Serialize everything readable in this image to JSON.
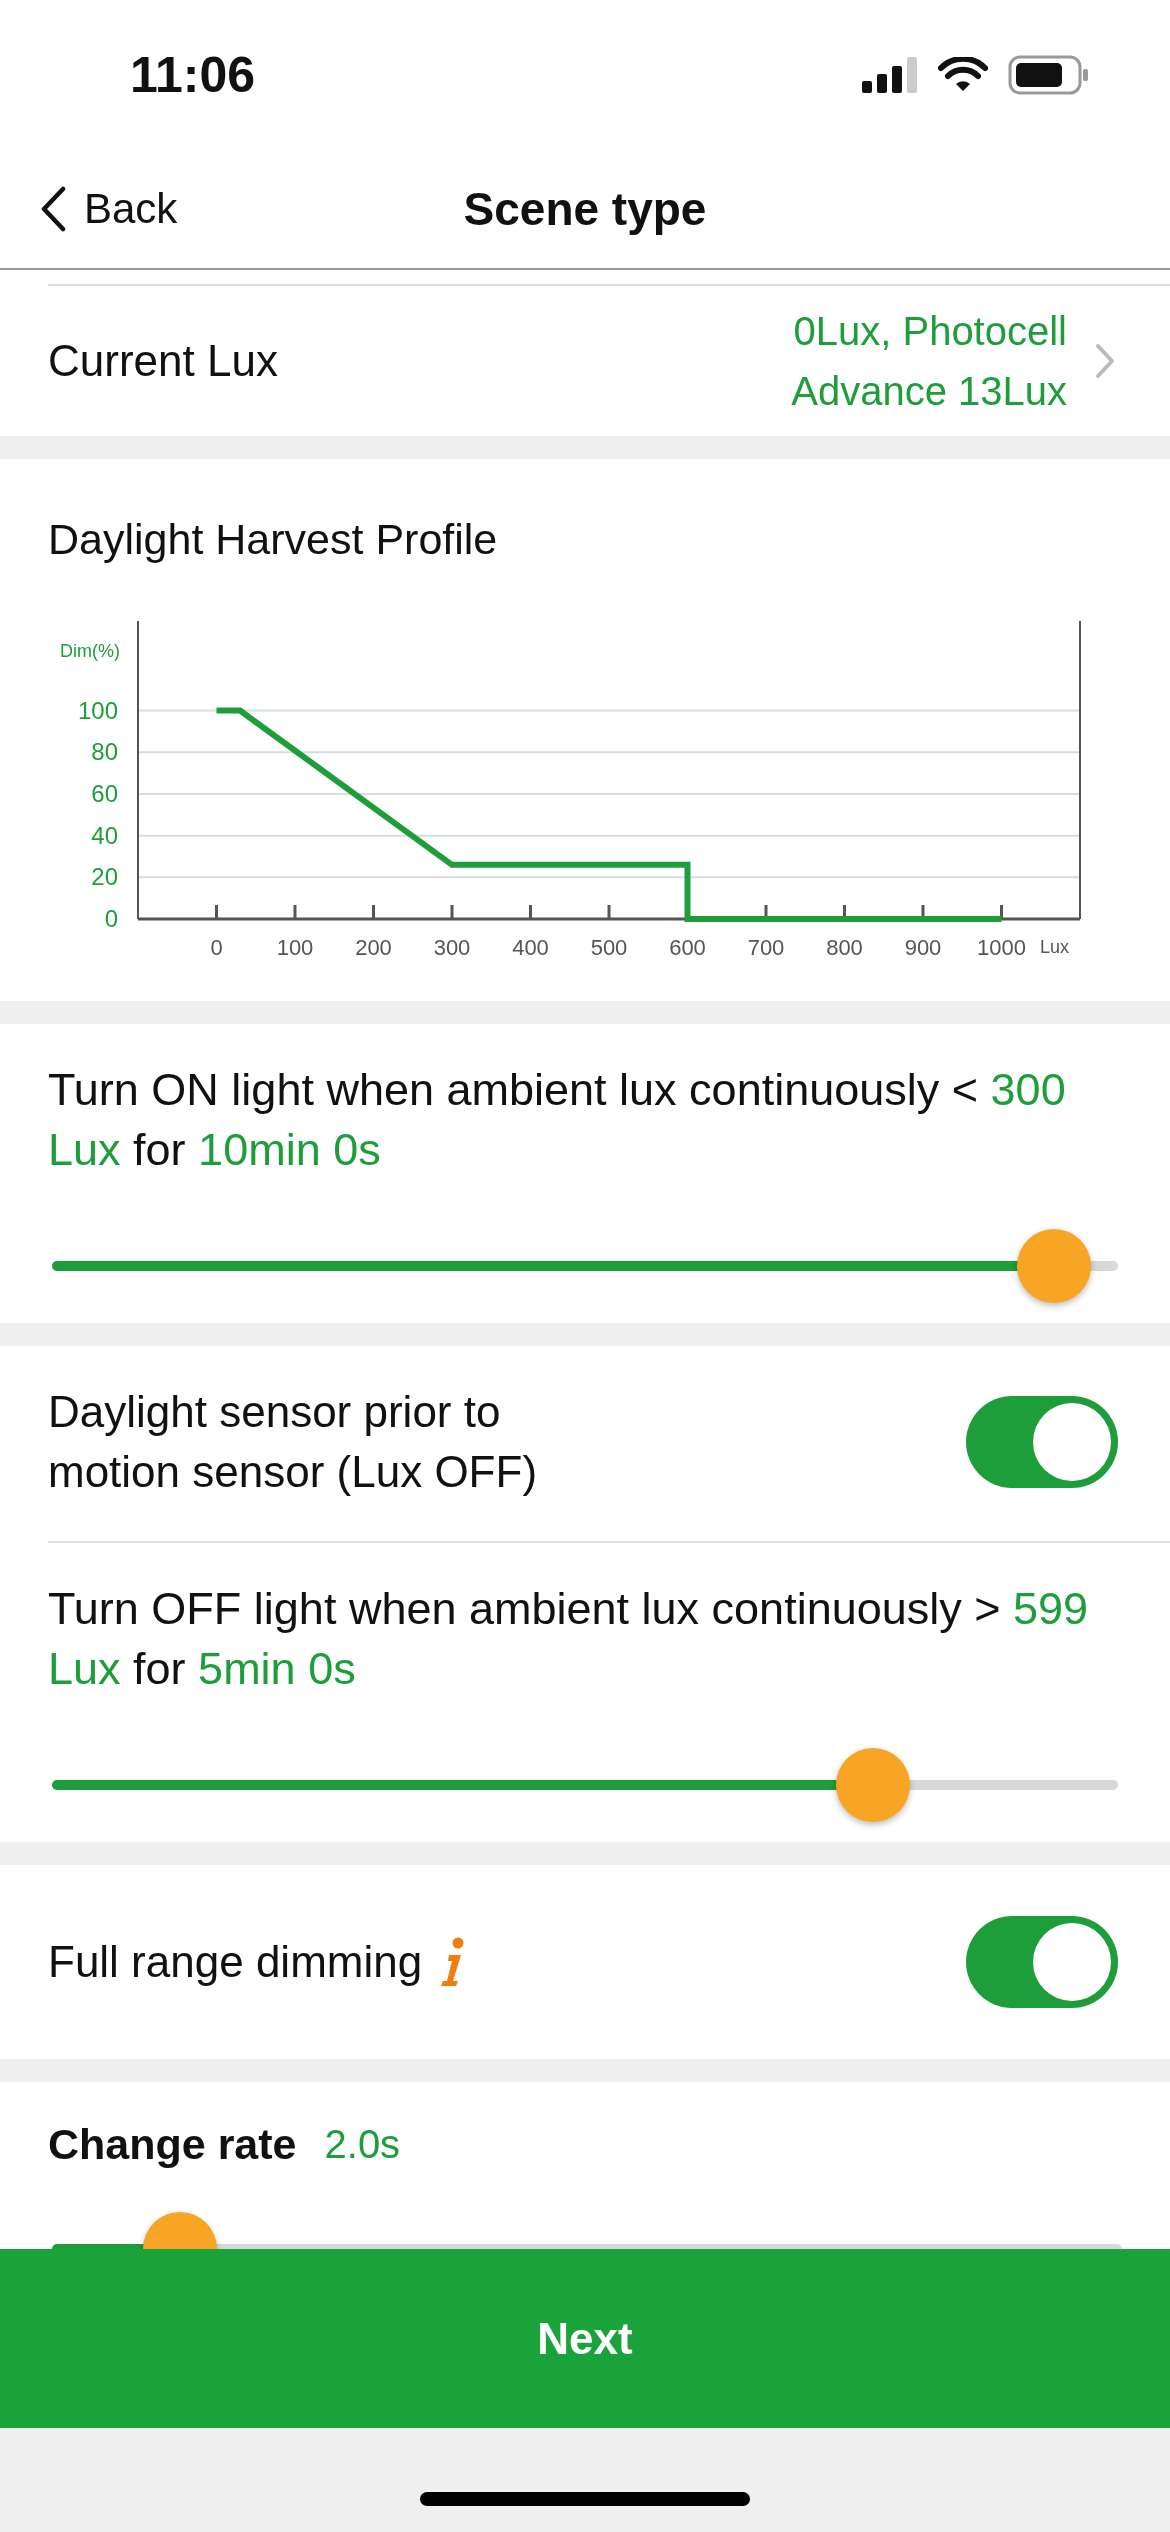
{
  "status_bar": {
    "time": "11:06"
  },
  "nav": {
    "back": "Back",
    "title": "Scene type"
  },
  "current_lux": {
    "label": "Current Lux",
    "value": "0Lux, Photocell Advance 13Lux"
  },
  "profile": {
    "title": "Daylight Harvest Profile",
    "chart_data": {
      "type": "line",
      "xlabel": "Lux",
      "ylabel": "Dim(%)",
      "x": [
        0,
        30,
        300,
        600,
        600,
        1000
      ],
      "series": [
        {
          "color": "#1e9e3a",
          "values": [
            100,
            100,
            26,
            26,
            0,
            0
          ]
        }
      ],
      "grid": true,
      "xlim": [
        -100,
        1100
      ],
      "ylim": [
        0,
        143
      ],
      "xticks": [
        0,
        100,
        200,
        300,
        400,
        500,
        600,
        700,
        800,
        900,
        1000
      ],
      "yticks": [
        0,
        20,
        40,
        60,
        80,
        100
      ]
    }
  },
  "sections": [
    {
      "items": [
        {
          "kind": "threshold",
          "parts": [
            {
              "text": "Turn ON light when ambient lux continuously <",
              "highlight": false
            },
            {
              "text": "300 Lux",
              "highlight": true
            },
            {
              "text": "for",
              "highlight": false
            },
            {
              "text": "10min 0s",
              "highlight": true
            }
          ],
          "level": 0.94
        }
      ]
    },
    {
      "items": [
        {
          "kind": "toggle",
          "label": "Daylight sensor prior to motion sensor (Lux OFF)",
          "on": true,
          "info": false
        },
        {
          "kind": "threshold",
          "parts": [
            {
              "text": "Turn OFF light when ambient lux continuously >",
              "highlight": false
            },
            {
              "text": "599 Lux",
              "highlight": true
            },
            {
              "text": "for",
              "highlight": false
            },
            {
              "text": "5min 0s",
              "highlight": true
            }
          ],
          "level": 0.77
        }
      ]
    },
    {
      "items": [
        {
          "kind": "toggle",
          "label": "Full range dimming",
          "on": true,
          "info": true
        }
      ]
    },
    {
      "items": [
        {
          "kind": "rate",
          "label": "Change rate",
          "value": "2.0s",
          "level": 0.12
        }
      ]
    }
  ],
  "next_button": "Next"
}
